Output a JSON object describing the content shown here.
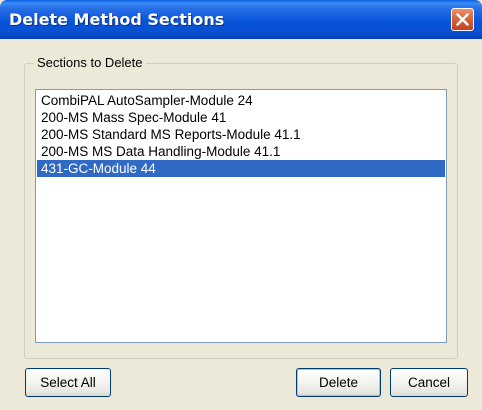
{
  "dialog": {
    "title": "Delete Method Sections",
    "close_icon": "close-icon"
  },
  "sections_group": {
    "label": "Sections to Delete",
    "items": [
      {
        "label": "CombiPAL AutoSampler-Module 24",
        "selected": false
      },
      {
        "label": "200-MS Mass Spec-Module 41",
        "selected": false
      },
      {
        "label": "200-MS Standard MS Reports-Module 41.1",
        "selected": false
      },
      {
        "label": "200-MS MS Data Handling-Module 41.1",
        "selected": false
      },
      {
        "label": "431-GC-Module 44",
        "selected": true
      }
    ]
  },
  "buttons": {
    "select_all": "Select All",
    "delete": "Delete",
    "cancel": "Cancel"
  },
  "colors": {
    "titlebar": "#0954da",
    "selection": "#316ac5",
    "dialog_bg": "#ece9d8",
    "close_button": "#d9653b"
  }
}
